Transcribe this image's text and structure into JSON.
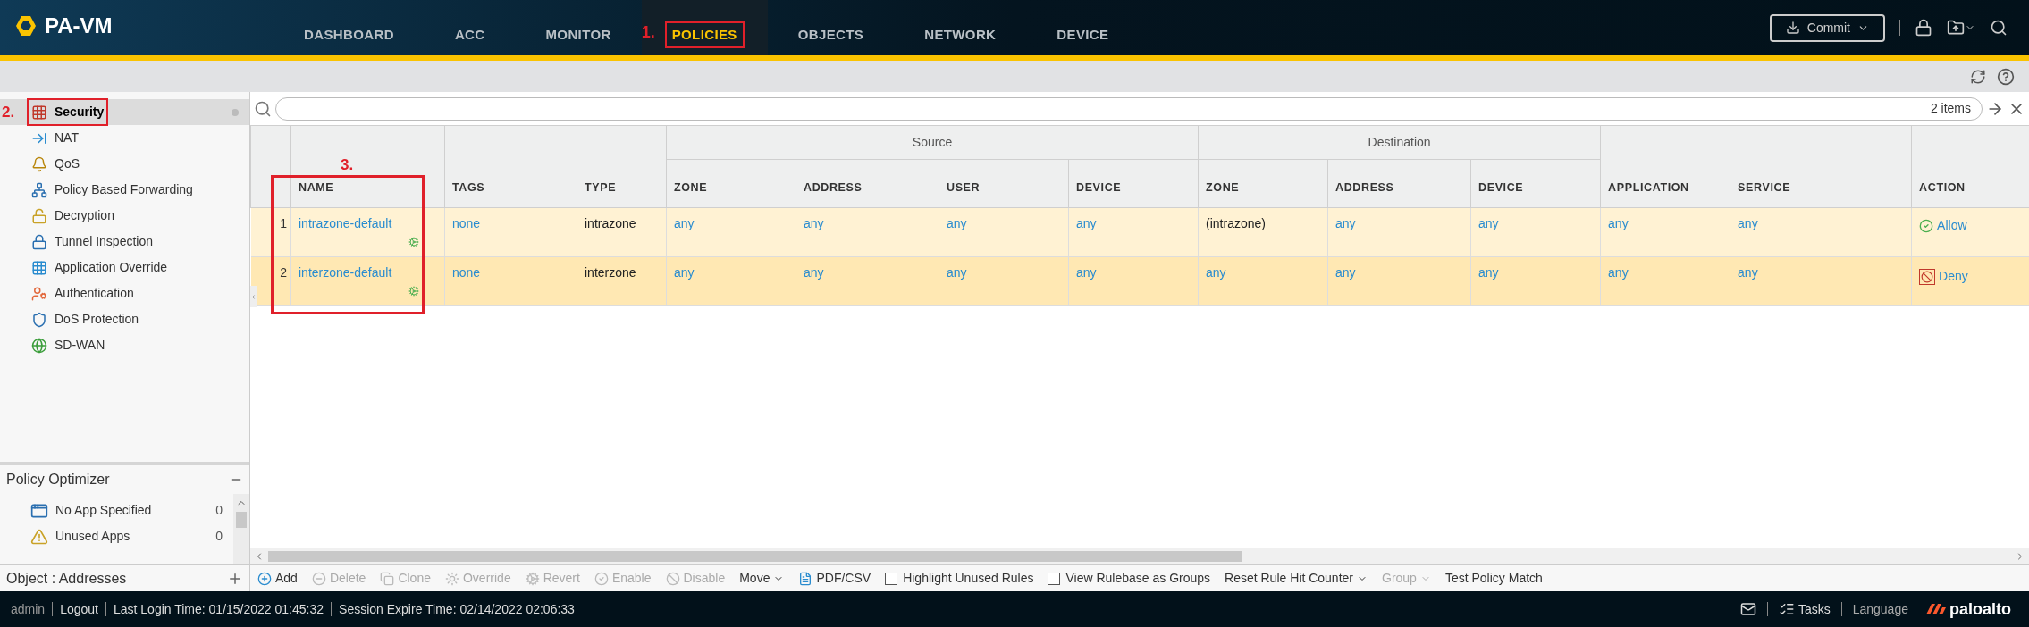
{
  "app": {
    "title": "PA-VM"
  },
  "nav": [
    {
      "label": "DASHBOARD",
      "selected": false
    },
    {
      "label": "ACC",
      "selected": false
    },
    {
      "label": "MONITOR",
      "selected": false
    },
    {
      "label": "POLICIES",
      "selected": true,
      "highlighted": true,
      "annotation": "1."
    },
    {
      "label": "OBJECTS",
      "selected": false
    },
    {
      "label": "NETWORK",
      "selected": false
    },
    {
      "label": "DEVICE",
      "selected": false
    }
  ],
  "commit_button": "Commit",
  "sidebar": {
    "items": [
      {
        "label": "Security",
        "kind": "security",
        "selected": true,
        "highlighted": true,
        "annotation": "2."
      },
      {
        "label": "NAT",
        "kind": "nat",
        "selected": false
      },
      {
        "label": "QoS",
        "kind": "qos",
        "selected": false
      },
      {
        "label": "Policy Based Forwarding",
        "kind": "pbf",
        "selected": false
      },
      {
        "label": "Decryption",
        "kind": "decryption",
        "selected": false
      },
      {
        "label": "Tunnel Inspection",
        "kind": "tunnel",
        "selected": false
      },
      {
        "label": "Application Override",
        "kind": "override",
        "selected": false
      },
      {
        "label": "Authentication",
        "kind": "auth",
        "selected": false
      },
      {
        "label": "DoS Protection",
        "kind": "dos",
        "selected": false
      },
      {
        "label": "SD-WAN",
        "kind": "sdwan",
        "selected": false
      }
    ]
  },
  "policy_optimizer": {
    "title": "Policy Optimizer",
    "items": [
      {
        "label": "No App Specified",
        "kind": "noapp",
        "count": "0"
      },
      {
        "label": "Unused Apps",
        "kind": "unused",
        "count": "0"
      }
    ]
  },
  "object_panel": {
    "title": "Object : Addresses"
  },
  "search": {
    "count": "2 items"
  },
  "table": {
    "column_groups": [
      "Source",
      "Destination"
    ],
    "columns": [
      {
        "label": "NAME",
        "highlighted": true,
        "annotation": "3."
      },
      {
        "label": "TAGS"
      },
      {
        "label": "TYPE"
      },
      {
        "label": "ZONE",
        "grouped": true,
        "group_start": true
      },
      {
        "label": "ADDRESS",
        "grouped": true
      },
      {
        "label": "USER",
        "grouped": true
      },
      {
        "label": "DEVICE",
        "grouped": true
      },
      {
        "label": "ZONE",
        "grouped": true,
        "group_start": true
      },
      {
        "label": "ADDRESS",
        "grouped": true
      },
      {
        "label": "DEVICE",
        "grouped": true
      },
      {
        "label": "APPLICATION"
      },
      {
        "label": "SERVICE"
      },
      {
        "label": "ACTION"
      }
    ],
    "rows": [
      {
        "index": "1",
        "cells": [
          {
            "text": "intrazone-default",
            "kind": "name"
          },
          {
            "text": "none",
            "kind": "link"
          },
          {
            "text": "intrazone",
            "kind": "plain"
          },
          {
            "text": "any",
            "kind": "link"
          },
          {
            "text": "any",
            "kind": "link"
          },
          {
            "text": "any",
            "kind": "link"
          },
          {
            "text": "any",
            "kind": "link"
          },
          {
            "text": "(intrazone)",
            "kind": "plain"
          },
          {
            "text": "any",
            "kind": "link"
          },
          {
            "text": "any",
            "kind": "link"
          },
          {
            "text": "any",
            "kind": "link"
          },
          {
            "text": "any",
            "kind": "link"
          },
          {
            "text": "Allow",
            "kind": "allow"
          }
        ]
      },
      {
        "index": "2",
        "cells": [
          {
            "text": "interzone-default",
            "kind": "name"
          },
          {
            "text": "none",
            "kind": "link"
          },
          {
            "text": "interzone",
            "kind": "plain"
          },
          {
            "text": "any",
            "kind": "link"
          },
          {
            "text": "any",
            "kind": "link"
          },
          {
            "text": "any",
            "kind": "link"
          },
          {
            "text": "any",
            "kind": "link"
          },
          {
            "text": "any",
            "kind": "link"
          },
          {
            "text": "any",
            "kind": "link"
          },
          {
            "text": "any",
            "kind": "link"
          },
          {
            "text": "any",
            "kind": "link"
          },
          {
            "text": "any",
            "kind": "link"
          },
          {
            "text": "Deny",
            "kind": "deny"
          }
        ]
      }
    ]
  },
  "toolbar": [
    {
      "label": "Add",
      "kind": "add",
      "disabled": false
    },
    {
      "label": "Delete",
      "kind": "delete",
      "disabled": true
    },
    {
      "label": "Clone",
      "kind": "clone",
      "disabled": true
    },
    {
      "label": "Override",
      "kind": "override",
      "disabled": true
    },
    {
      "label": "Revert",
      "kind": "revert",
      "disabled": true
    },
    {
      "label": "Enable",
      "kind": "enable",
      "disabled": true
    },
    {
      "label": "Disable",
      "kind": "disable",
      "disabled": true
    },
    {
      "label": "Move",
      "kind": "dropdown",
      "disabled": false
    },
    {
      "label": "PDF/CSV",
      "kind": "pdf",
      "disabled": false
    },
    {
      "label": "Highlight Unused Rules",
      "kind": "checkbox",
      "checked": false,
      "disabled": false
    },
    {
      "label": "View Rulebase as Groups",
      "kind": "checkbox",
      "checked": false,
      "disabled": false
    },
    {
      "label": "Reset Rule Hit Counter",
      "kind": "dropdown",
      "disabled": false
    },
    {
      "label": "Group",
      "kind": "dropdown",
      "disabled": true
    },
    {
      "label": "Test Policy Match",
      "kind": "plain",
      "disabled": false
    }
  ],
  "status_bar": {
    "user": "admin",
    "logout": "Logout",
    "last_login": "Last Login Time: 01/15/2022 01:45:32",
    "session_expire": "Session Expire Time: 02/14/2022 02:06:33",
    "tasks": "Tasks",
    "language": "Language",
    "logo": "paloalto"
  }
}
